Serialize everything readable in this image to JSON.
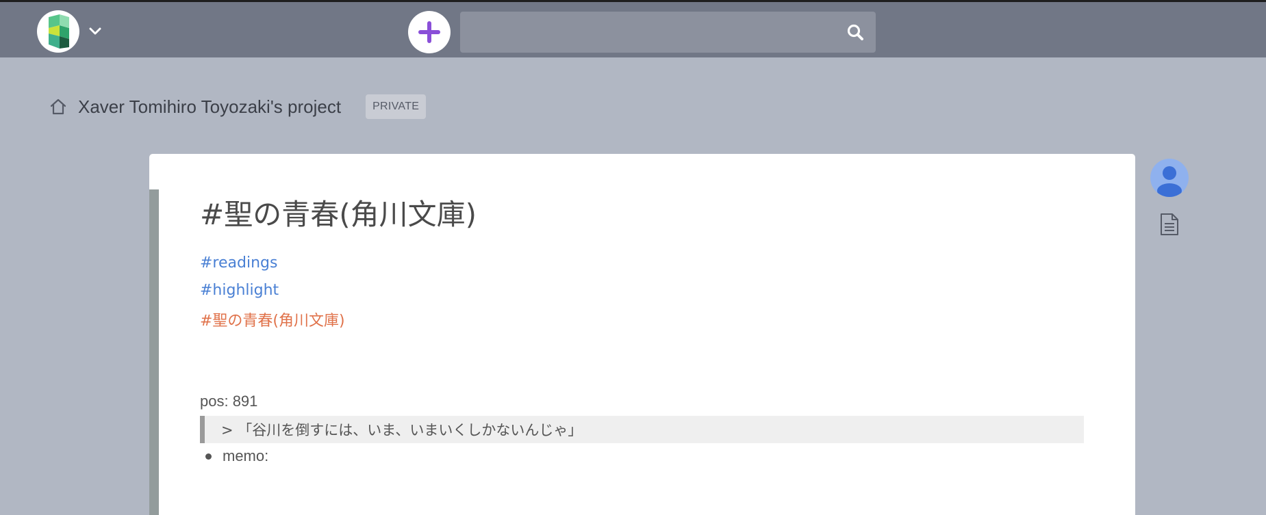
{
  "navbar": {
    "logo_icon": "scrapbox-logo-icon",
    "menu_icon": "chevron-down-icon",
    "new_page_icon": "plus-icon",
    "search": {
      "value": "",
      "placeholder": "",
      "icon": "search-icon"
    },
    "colors": {
      "bar": "#717786",
      "plus": "#8a4fd8"
    }
  },
  "project": {
    "home_icon": "home-icon",
    "title": "Xaver Tomihiro Toyozaki's project",
    "visibility": "PRIVATE"
  },
  "page": {
    "title": "#聖の青春(角川文庫)",
    "tags": [
      {
        "label": "#readings",
        "kind": "link",
        "color": "#4a80d4"
      },
      {
        "label": "#highlight",
        "kind": "link",
        "color": "#4a80d4"
      },
      {
        "label": "#聖の青春(角川文庫)",
        "kind": "current",
        "color": "#e0724a"
      }
    ],
    "pos_line": "pos: 891",
    "quote": "> 「谷川を倒すには、いま、いまいくしかないんじゃ」",
    "memo": "memo:"
  },
  "side_tools": {
    "avatar_icon": "user-avatar-icon",
    "doc_icon": "document-icon"
  }
}
